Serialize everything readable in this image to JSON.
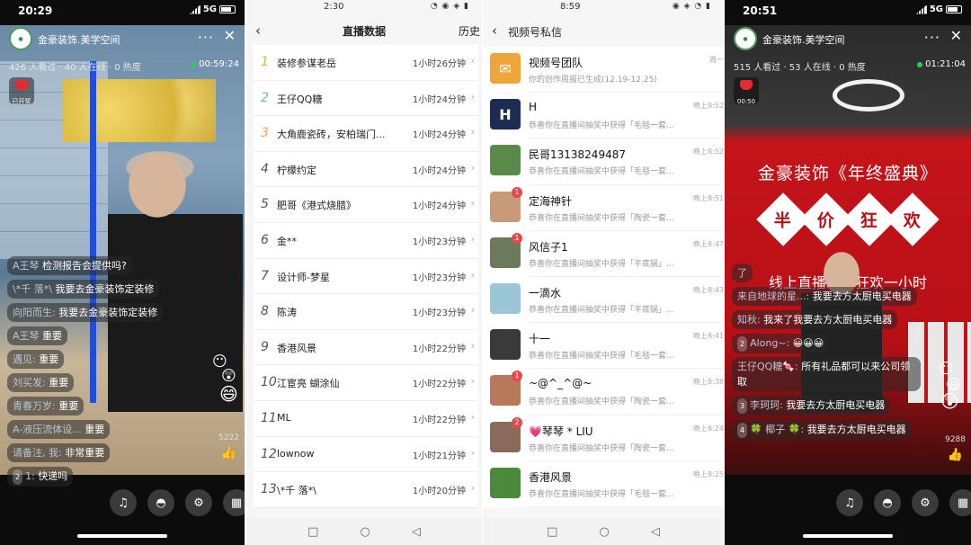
{
  "live_left": {
    "status": {
      "time": "20:29",
      "network": "5G"
    },
    "room_name": "金豪装饰.美学空间",
    "more": "···",
    "close": "✕",
    "stats": "426 人看过 · 40 人在线 · 0 热度",
    "live_time": "00:59:24",
    "gift_label": "已开奖",
    "comments": [
      {
        "user": "A王琴",
        "text": "检测报告会提供吗?"
      },
      {
        "user": "\\*千 落*\\",
        "text": "我要去金豪装饰定装修"
      },
      {
        "user": "向阳而生:",
        "text": "我要去金豪装饰定装修"
      },
      {
        "user": "A王琴",
        "text": "重要"
      },
      {
        "user": "遇见:",
        "text": "重要"
      },
      {
        "user": "刘买发:",
        "text": "重要"
      },
      {
        "user": "青春万岁:",
        "text": "重要"
      },
      {
        "user": "A-液压流体设...",
        "text": "重要"
      },
      {
        "user": "请备注, 我:",
        "text": "非常重要"
      },
      {
        "badge": "2",
        "user": "1:",
        "text": "快递吗"
      }
    ],
    "likes": "5222",
    "controls": [
      "music-icon",
      "bag-icon",
      "settings-icon",
      "apps-icon"
    ]
  },
  "live_data": {
    "status": {
      "time": "2:30"
    },
    "title": "直播数据",
    "history": "历史",
    "back": "‹",
    "rows": [
      {
        "rank": "1",
        "name": "装修参谋老岳",
        "duration": "1小时26分钟"
      },
      {
        "rank": "2",
        "name": "王仔QQ糖",
        "duration": "1小时24分钟"
      },
      {
        "rank": "3",
        "name": "大角鹿瓷砖，安柏瑞门...",
        "duration": "1小时24分钟"
      },
      {
        "rank": "4",
        "name": "柠檬约定",
        "duration": "1小时24分钟"
      },
      {
        "rank": "5",
        "name": "肥哥《港式烧腊》",
        "duration": "1小时24分钟"
      },
      {
        "rank": "6",
        "name": "金**",
        "duration": "1小时23分钟"
      },
      {
        "rank": "7",
        "name": "设计师-梦星",
        "duration": "1小时23分钟"
      },
      {
        "rank": "8",
        "name": "陈涛",
        "duration": "1小时23分钟"
      },
      {
        "rank": "9",
        "name": "香港风景",
        "duration": "1小时22分钟"
      },
      {
        "rank": "10",
        "name": "江宦亮    蝴涂仙",
        "duration": "1小时22分钟"
      },
      {
        "rank": "11",
        "name": "ML",
        "duration": "1小时22分钟"
      },
      {
        "rank": "12",
        "name": "lownow",
        "duration": "1小时21分钟"
      },
      {
        "rank": "13",
        "name": "\\*千 落*\\",
        "duration": "1小时20分钟"
      }
    ],
    "nav": [
      "□",
      "○",
      "◁"
    ]
  },
  "messages": {
    "status": {
      "time": "8:59"
    },
    "title": "视频号私信",
    "back": "‹",
    "items": [
      {
        "name": "视频号团队",
        "preview": "你的创作周报已生成(12.19-12.25)",
        "time": "周一",
        "unread": "",
        "color": "#f0a53a"
      },
      {
        "name": "H",
        "preview": "恭喜你在直播间抽奖中获得「毛毯一套...",
        "time": "晚上8:52",
        "unread": "",
        "color": "#1c2c55"
      },
      {
        "name": "民哥13138249487",
        "preview": "恭喜你在直播间抽奖中获得「毛毯一套...",
        "time": "晚上8:52",
        "unread": "",
        "color": "#5a8a4a"
      },
      {
        "name": "定海神针",
        "preview": "恭喜你在直播间抽奖中获得「陶瓷一套...",
        "time": "晚上8:51",
        "unread": "1",
        "color": "#c89a7a"
      },
      {
        "name": "风信子1",
        "preview": "恭喜你在直播间抽奖中获得「平底锅」...",
        "time": "晚上8:47",
        "unread": "1",
        "color": "#6a7a5a"
      },
      {
        "name": "一滴水",
        "preview": "恭喜你在直播间抽奖中获得「平底锅」...",
        "time": "晚上8:43",
        "unread": "",
        "color": "#9ac6d8"
      },
      {
        "name": "十一",
        "preview": "恭喜你在直播间抽奖中获得「毛毯一套...",
        "time": "晚上8:41",
        "unread": "",
        "color": "#3a3a3a"
      },
      {
        "name": "~@^_^@~",
        "preview": "恭喜你在直播间抽奖中获得「陶瓷一套...",
        "time": "晚上8:38",
        "unread": "1",
        "color": "#b8785a"
      },
      {
        "name": "💗琴琴 * LIU",
        "preview": "恭喜你在直播间抽奖中获得「陶瓷一套...",
        "time": "晚上8:24",
        "unread": "2",
        "color": "#8a6a5a"
      },
      {
        "name": "香港风景",
        "preview": "恭喜你在直播间抽奖中获得「毛毯一套...",
        "time": "晚上8:25",
        "unread": "",
        "color": "#4a8a3a"
      }
    ],
    "nav": [
      "□",
      "○",
      "◁"
    ]
  },
  "live_right": {
    "status": {
      "time": "20:51",
      "network": "5G"
    },
    "room_name": "金豪装饰.美学空间",
    "more": "···",
    "close": "✕",
    "stats": "515 人看过 · 53 人在线 · 0 热度",
    "live_time": "01:21:04",
    "gift_label": "00:50",
    "banner_title": "金豪装饰《年终盛典》",
    "banner_chars": [
      "半",
      "价",
      "狂",
      "欢"
    ],
    "subbanner": "线上直播终极狂欢一小时",
    "comments": [
      {
        "user": "了",
        "text": ""
      },
      {
        "user": "来自地球的星...:",
        "text": "我要去方太厨电买电器"
      },
      {
        "user": "知秋:",
        "text": "我来了我要去方太厨电买电器"
      },
      {
        "badge": "2",
        "user": "Along~:",
        "text": "😀😀😀"
      },
      {
        "user": "王仔QQ糖🍬:",
        "text": "所有礼品都可以来公司领取"
      },
      {
        "badge": "3",
        "user": "李珂珂:",
        "text": "我要去方太厨电买电器"
      },
      {
        "badge": "4",
        "user": "🍀 椰子 🍀:",
        "text": "我要去方太厨电买电器"
      }
    ],
    "likes": "9288",
    "controls": [
      "music-icon",
      "bag-icon",
      "settings-icon",
      "apps-icon"
    ]
  }
}
